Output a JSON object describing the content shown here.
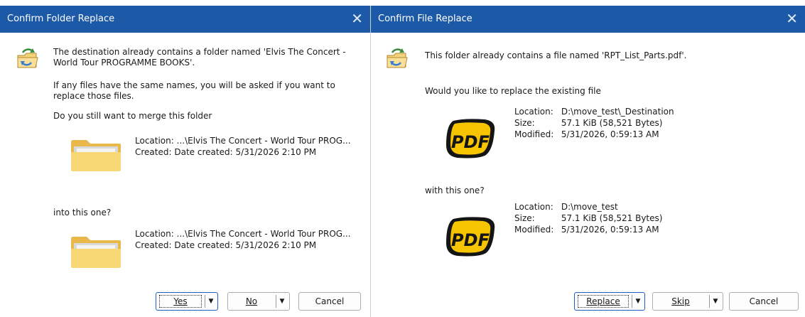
{
  "folder_dialog": {
    "title": "Confirm Folder Replace",
    "close_glyph": "✕",
    "message_line1": "The destination already contains a folder named 'Elvis The Concert -",
    "message_line2": "World Tour PROGRAMME BOOKS'.",
    "info_line1": "If any files have the same names, you will be asked if you want to",
    "info_line2": "replace those files.",
    "question": "Do you still want to merge this folder",
    "source": {
      "location_label": "Location:",
      "location_value": "...\\Elvis The Concert - World Tour PROG...",
      "created_label": "Created:",
      "created_value": "Date created: 5/31/2026  2:10 PM"
    },
    "into_label": "into this one?",
    "destination": {
      "location_label": "Location:",
      "location_value": "...\\Elvis The Concert - World Tour PROG...",
      "created_label": "Created:",
      "created_value": "Date created: 5/31/2026  2:10 PM"
    },
    "buttons": {
      "yes": "Yes",
      "no": "No",
      "cancel": "Cancel",
      "dropdown_glyph": "▼"
    },
    "icons": {
      "header": "folder-sync-icon",
      "source": "folder-icon",
      "destination": "folder-icon"
    }
  },
  "file_dialog": {
    "title": "Confirm File Replace",
    "close_glyph": "✕",
    "message": "This folder already contains a file named 'RPT_List_Parts.pdf'.",
    "question": "Would you like to replace the existing file",
    "existing": {
      "location_label": "Location:",
      "location_value": "D:\\move_test\\_Destination",
      "size_label": "Size:",
      "size_value": "57.1 KiB (58,521 Bytes)",
      "modified_label": "Modified:",
      "modified_value": "5/31/2026, 0:59:13 AM"
    },
    "with_label": "with this one?",
    "incoming": {
      "location_label": "Location:",
      "location_value": "D:\\move_test",
      "size_label": "Size:",
      "size_value": "57.1 KiB (58,521 Bytes)",
      "modified_label": "Modified:",
      "modified_value": "5/31/2026, 0:59:13 AM"
    },
    "pdf_icon_text": "PDF",
    "buttons": {
      "replace": "Replace",
      "skip": "Skip",
      "cancel": "Cancel",
      "dropdown_glyph": "▼"
    },
    "icons": {
      "header": "folder-sync-icon",
      "existing": "pdf-file-icon",
      "incoming": "pdf-file-icon"
    }
  },
  "colors": {
    "titlebar": "#1c5aa8",
    "title_text": "#ffffff",
    "default_button_border": "#1d5fc7",
    "pdf_yellow": "#f6c400",
    "folder_yellow": "#f7d774"
  }
}
